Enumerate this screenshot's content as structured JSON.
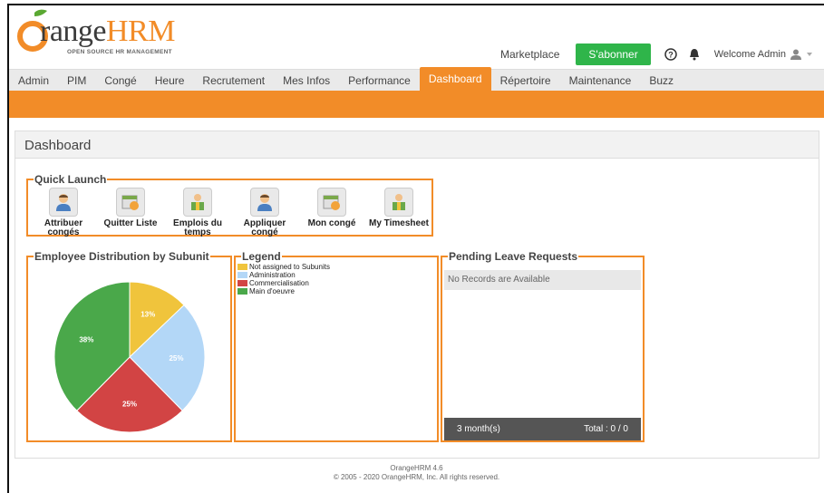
{
  "header": {
    "logo_main": "range",
    "logo_brand": "HRM",
    "logo_tagline": "OPEN SOURCE HR MANAGEMENT",
    "marketplace": "Marketplace",
    "subscribe": "S'abonner",
    "welcome": "Welcome Admin",
    "help_icon": "help-icon",
    "bell_icon": "bell-icon",
    "user_icon": "user-icon"
  },
  "menu": {
    "items": [
      "Admin",
      "PIM",
      "Congé",
      "Heure",
      "Recrutement",
      "Mes Infos",
      "Performance",
      "Dashboard",
      "Répertoire",
      "Maintenance",
      "Buzz"
    ],
    "active": "Dashboard"
  },
  "dashboard": {
    "title": "Dashboard",
    "quick_launch": {
      "title": "Quick Launch",
      "items": [
        {
          "label": "Attribuer congés",
          "icon": "user-icon"
        },
        {
          "label": "Quitter Liste",
          "icon": "calendar-icon"
        },
        {
          "label": "Emplois du temps",
          "icon": "timesheet-icon"
        },
        {
          "label": "Appliquer congé",
          "icon": "user-icon"
        },
        {
          "label": "Mon congé",
          "icon": "calendar-icon"
        },
        {
          "label": "My Timesheet",
          "icon": "timesheet-icon"
        }
      ]
    },
    "distribution_title": "Employee Distribution by Subunit",
    "legend_title": "Legend",
    "pending_title": "Pending Leave Requests",
    "pending_empty": "No Records are Available",
    "pending_period": "3 month(s)",
    "pending_total": "Total : 0 / 0"
  },
  "chart_data": {
    "type": "pie",
    "categories": [
      "Not assigned to Subunits",
      "Administration",
      "Commercialisation",
      "Main d'oeuvre"
    ],
    "values": [
      13,
      25,
      25,
      38
    ],
    "labels": [
      "13%",
      "25%",
      "25%",
      "38%"
    ],
    "colors": [
      "#f0c43c",
      "#b3d7f7",
      "#d24444",
      "#4aa84a"
    ]
  },
  "footer": {
    "line1": "OrangeHRM 4.6",
    "line2": "© 2005 - 2020 OrangeHRM, Inc. All rights reserved."
  }
}
